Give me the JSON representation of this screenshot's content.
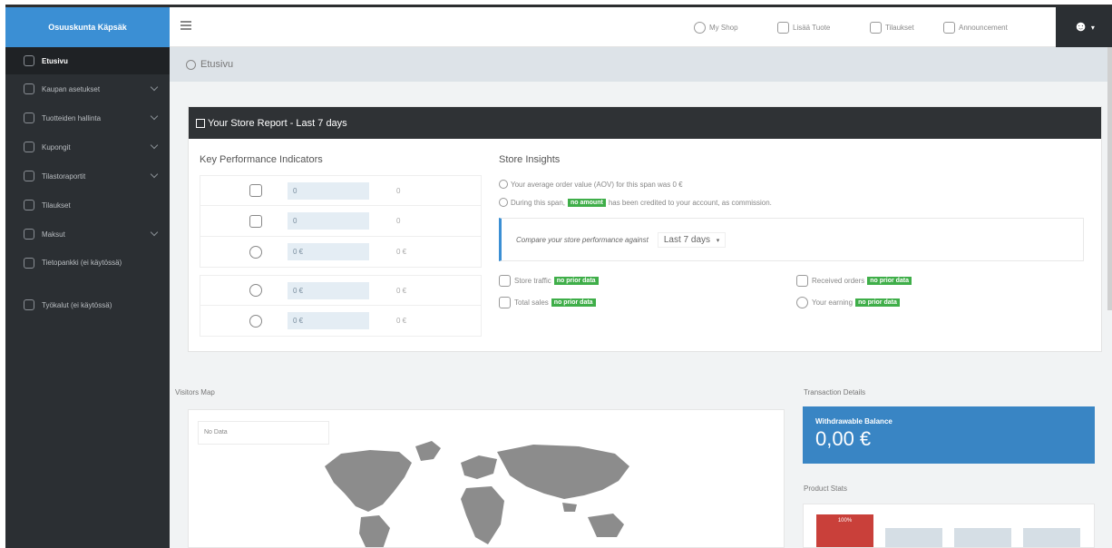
{
  "sidebar": {
    "brand": "Osuuskunta Käpsäk",
    "items": [
      {
        "label": "Etusivu",
        "icon": "home-icon",
        "active": true,
        "has_children": false
      },
      {
        "label": "Kaupan asetukset",
        "icon": "store-settings-icon",
        "active": false,
        "has_children": true
      },
      {
        "label": "Tuotteiden hallinta",
        "icon": "products-icon",
        "active": false,
        "has_children": true
      },
      {
        "label": "Kupongit",
        "icon": "coupon-icon",
        "active": false,
        "has_children": true
      },
      {
        "label": "Tilastoraportit",
        "icon": "reports-icon",
        "active": false,
        "has_children": true
      },
      {
        "label": "Tilaukset",
        "icon": "orders-icon",
        "active": false,
        "has_children": false
      },
      {
        "label": "Maksut",
        "icon": "payments-icon",
        "active": false,
        "has_children": true
      },
      {
        "label": "Tietopankki (ei käytössä)",
        "icon": "knowledgebase-icon",
        "active": false,
        "has_children": false
      },
      {
        "label": "Työkalut (ei käytössä)",
        "icon": "tools-icon",
        "active": false,
        "has_children": false
      }
    ]
  },
  "topbar": {
    "nav": [
      {
        "label": "My Shop",
        "icon": "globe-icon"
      },
      {
        "label": "Lisää Tuote",
        "icon": "add-product-icon"
      },
      {
        "label": "Tilaukset",
        "icon": "orders-icon"
      },
      {
        "label": "Announcement",
        "icon": "megaphone-icon"
      }
    ],
    "user_icon": "user-icon"
  },
  "breadcrumb": {
    "label": "Etusivu"
  },
  "report": {
    "title": "Your Store Report - Last 7 days",
    "kpi_title": "Key Performance Indicators",
    "kpis": [
      {
        "icon": "rocket-icon",
        "value": "0",
        "change": "0"
      },
      {
        "icon": "cart-icon",
        "value": "0",
        "change": "0"
      },
      {
        "icon": "medal-icon",
        "value": "0 €",
        "change": "0 €"
      },
      {
        "icon": "apple-icon",
        "value": "0 €",
        "change": "0 €"
      },
      {
        "icon": "money-bag-icon",
        "value": "0 €",
        "change": "0 €"
      }
    ],
    "insights_title": "Store Insights",
    "insight_aov": "Your average order value (AOV) for this span was 0 €",
    "insight_commission_pre": "During this span,",
    "insight_commission_badge": "no amount",
    "insight_commission_post": "has been credited to your account, as commission.",
    "compare_label": "Compare your store performance against",
    "compare_value": "Last 7 days",
    "stats": [
      {
        "label": "Store traffic",
        "badge": "no prior data",
        "icon": "traffic-icon"
      },
      {
        "label": "Received orders",
        "badge": "no prior data",
        "icon": "cart-icon"
      },
      {
        "label": "Total sales",
        "badge": "no prior data",
        "icon": "sales-icon"
      },
      {
        "label": "Your earning",
        "badge": "no prior data",
        "icon": "earning-icon"
      }
    ]
  },
  "visitors_map": {
    "title": "Visitors Map",
    "no_data": "No Data"
  },
  "transactions": {
    "title": "Transaction Details",
    "balance_label": "Withdrawable Balance",
    "balance_value": "0,00 €"
  },
  "product_stats": {
    "title": "Product Stats",
    "bar_label": "100%"
  }
}
